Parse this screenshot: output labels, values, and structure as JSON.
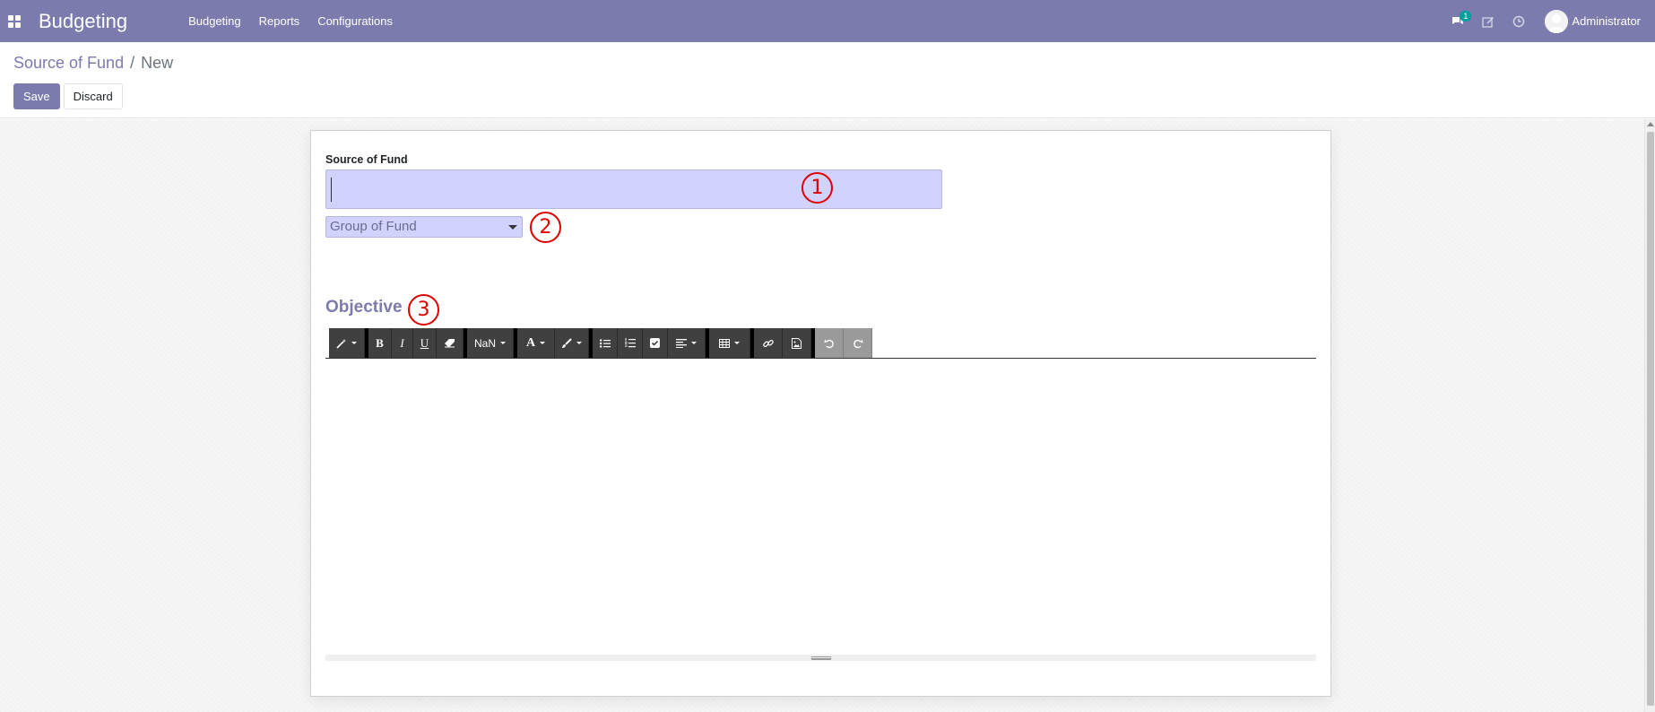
{
  "navbar": {
    "brand": "Budgeting",
    "menu": [
      {
        "label": "Budgeting"
      },
      {
        "label": "Reports"
      },
      {
        "label": "Configurations"
      }
    ],
    "messages_badge": "1",
    "user_name": "Administrator",
    "color": "#7c7bad"
  },
  "breadcrumb": {
    "parent": "Source of Fund",
    "separator": "/",
    "current": "New"
  },
  "actions": {
    "save_label": "Save",
    "discard_label": "Discard"
  },
  "form": {
    "field_label": "Source of Fund",
    "name_value": "",
    "group_select_value": "Group of Fund",
    "section_title": "Objective",
    "input_bg": "#d2d2ff"
  },
  "editor_toolbar": {
    "font_size_label": "NaN",
    "bold_label": "B",
    "italic_label": "I",
    "underline_label": "U",
    "font_color_label": "A",
    "icons": [
      "magic-wand-icon",
      "eraser-icon",
      "paintbrush-icon",
      "bullet-list-icon",
      "numbered-list-icon",
      "checklist-icon",
      "align-icon",
      "table-icon",
      "link-icon",
      "image-icon",
      "undo-icon",
      "redo-icon"
    ]
  },
  "annotations": [
    "1",
    "2",
    "3"
  ]
}
